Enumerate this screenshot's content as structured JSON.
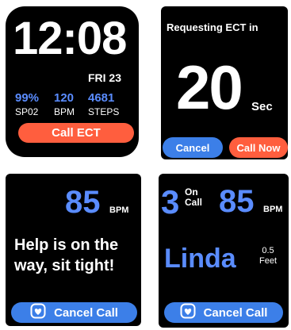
{
  "watch_clock": {
    "time": "12:08",
    "date": "FRI 23",
    "stats": [
      {
        "value": "99%",
        "label": "SP02"
      },
      {
        "value": "120",
        "label": "BPM"
      },
      {
        "value": "4681",
        "label": "STEPS"
      }
    ],
    "call_button": "Call ECT"
  },
  "watch_request": {
    "title": "Requesting ECT in",
    "countdown": "20",
    "unit": "Sec",
    "cancel_button": "Cancel",
    "call_now_button": "Call Now"
  },
  "watch_help": {
    "heart_rate": "85",
    "heart_unit": "BPM",
    "message_line1": "Help is on the",
    "message_line2": "way, sit tight!",
    "cancel_call_button": "Cancel Call"
  },
  "watch_oncall": {
    "on_call_count": "3",
    "on_call_line1": "On",
    "on_call_line2": "Call",
    "heart_rate": "85",
    "heart_unit": "BPM",
    "responder_name": "Linda",
    "distance_value": "0.5",
    "distance_unit": "Feet",
    "cancel_call_button": "Cancel Call"
  },
  "colors": {
    "accent_blue": "#5a8cff",
    "button_blue": "#3c7fe8",
    "alert_red": "#ff5e3e",
    "background": "#000000"
  }
}
